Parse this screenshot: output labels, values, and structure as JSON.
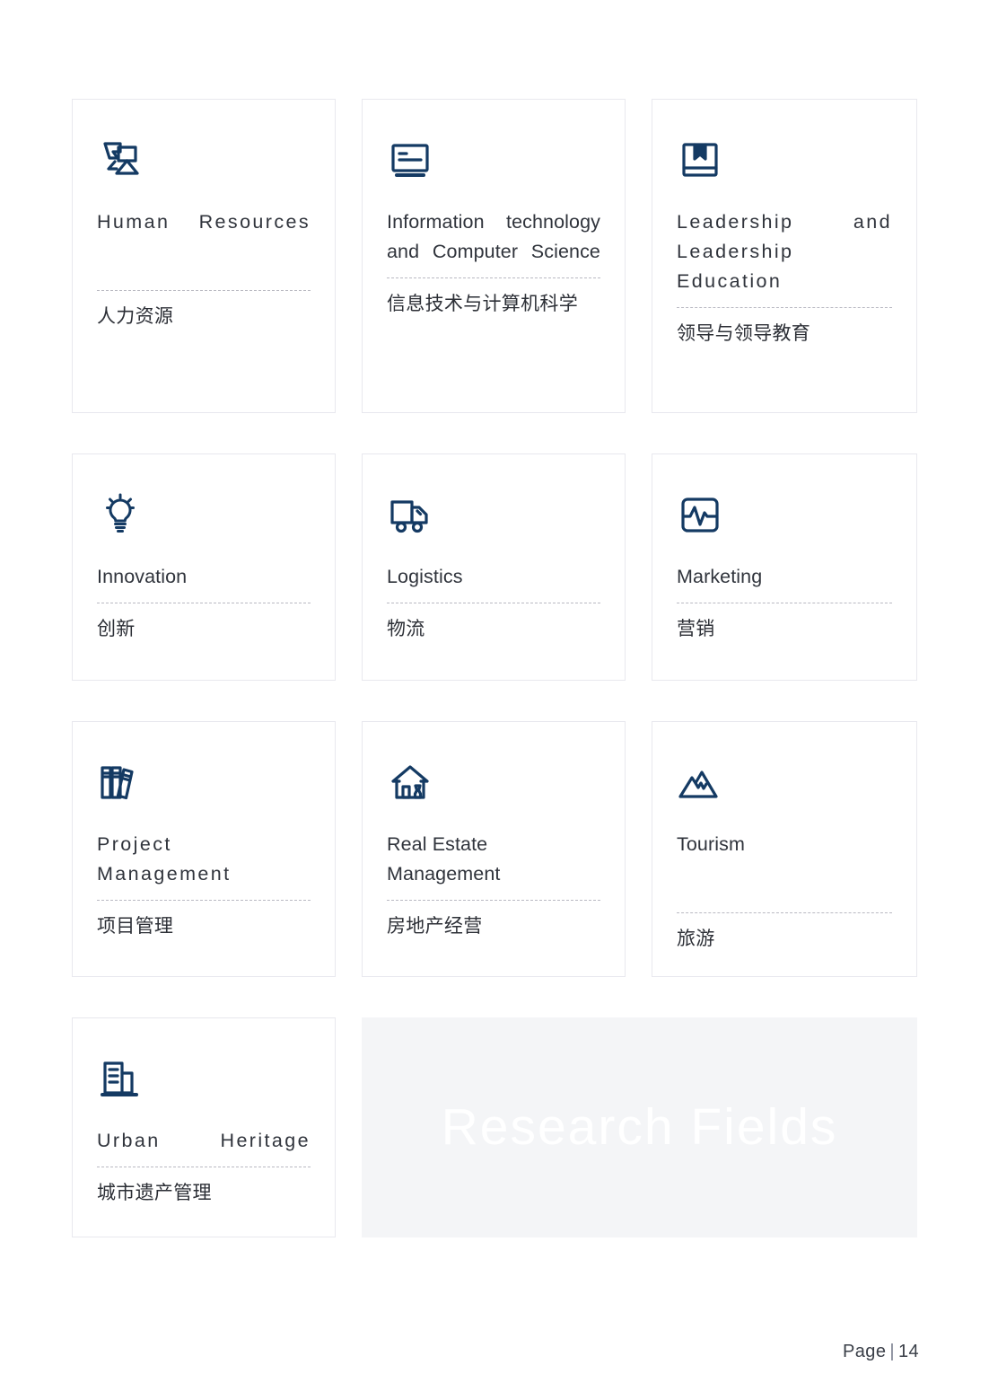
{
  "page": {
    "footer_label": "Page",
    "footer_separator": "|",
    "footer_number": "14",
    "watermark": "Research Fields",
    "accent_color": "#143a63",
    "border_color": "#e8e8ee",
    "panel_color": "#f4f5f7"
  },
  "cards": [
    {
      "icon": "group-people-icon",
      "title_en": "Human Resources",
      "title_zh": "人力资源"
    },
    {
      "icon": "monitor-text-icon",
      "title_en": "Information technology and Computer Science",
      "title_zh": "信息技术与计算机科学"
    },
    {
      "icon": "book-bookmark-icon",
      "title_en": "Leadership and Leadership Education",
      "title_zh": "领导与领导教育"
    },
    {
      "icon": "lightbulb-icon",
      "title_en": "Innovation",
      "title_zh": "创新"
    },
    {
      "icon": "delivery-truck-icon",
      "title_en": "Logistics",
      "title_zh": "物流"
    },
    {
      "icon": "pulse-chart-icon",
      "title_en": "Marketing",
      "title_zh": "营销"
    },
    {
      "icon": "books-shelf-icon",
      "title_en": "Project Management",
      "title_zh": "项目管理"
    },
    {
      "icon": "house-icon",
      "title_en": "Real Estate Management",
      "title_zh": "房地产经营"
    },
    {
      "icon": "mountains-icon",
      "title_en": "Tourism",
      "title_zh": "旅游"
    },
    {
      "icon": "building-icon",
      "title_en": "Urban Heritage",
      "title_zh": "城市遗产管理"
    }
  ]
}
